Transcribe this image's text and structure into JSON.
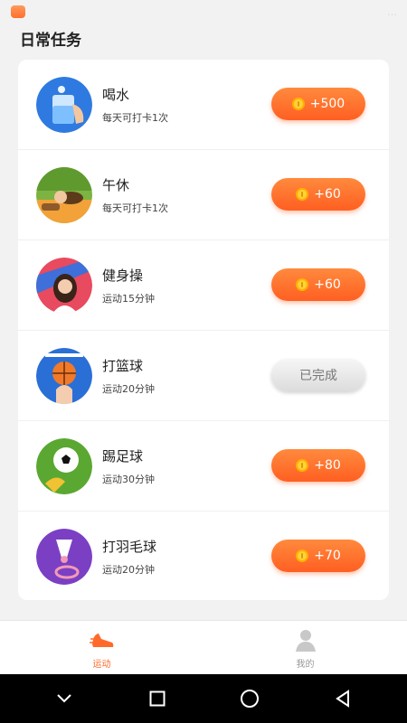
{
  "status_bar": {
    "right_text": "…"
  },
  "page_title": "日常任务",
  "tasks": [
    {
      "name": "喝水",
      "desc": "每天可打卡1次",
      "reward": "+500",
      "status": "reward",
      "icon": "water-icon"
    },
    {
      "name": "午休",
      "desc": "每天可打卡1次",
      "reward": "+60",
      "status": "reward",
      "icon": "nap-icon"
    },
    {
      "name": "健身操",
      "desc": "运动15分钟",
      "reward": "+60",
      "status": "reward",
      "icon": "aerobics-icon"
    },
    {
      "name": "打篮球",
      "desc": "运动20分钟",
      "reward": "已完成",
      "status": "done",
      "icon": "basketball-icon"
    },
    {
      "name": "踢足球",
      "desc": "运动30分钟",
      "reward": "+80",
      "status": "reward",
      "icon": "soccer-icon"
    },
    {
      "name": "打羽毛球",
      "desc": "运动20分钟",
      "reward": "+70",
      "status": "reward",
      "icon": "badminton-icon"
    }
  ],
  "tab_bar": {
    "tabs": [
      {
        "label": "运动",
        "icon": "sneaker-icon",
        "active": true
      },
      {
        "label": "我的",
        "icon": "profile-icon",
        "active": false
      }
    ]
  },
  "colors": {
    "accent": "#ff6a2b",
    "done": "#777777"
  }
}
